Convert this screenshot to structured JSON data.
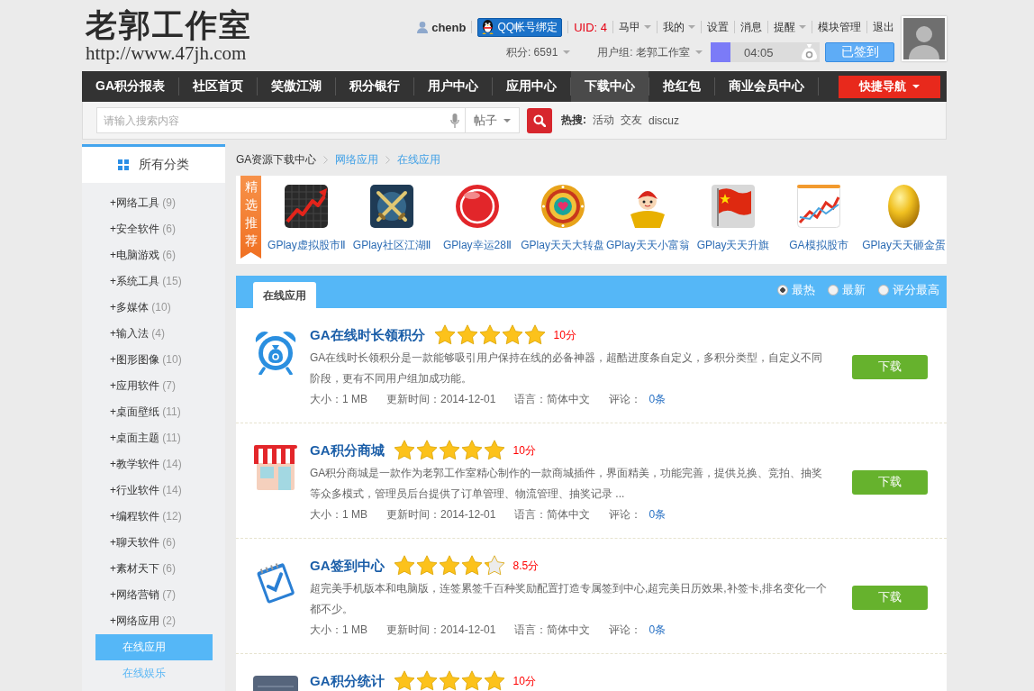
{
  "header": {
    "logo": "老郭工作室",
    "url": "http://www.47jh.com",
    "user": {
      "name": "chenb",
      "qq_bind": "QQ帐号绑定",
      "uid": "UID: 4"
    },
    "links": [
      {
        "label": "马甲",
        "dropdown": true
      },
      {
        "label": "我的",
        "dropdown": true
      },
      {
        "label": "设置",
        "dropdown": false
      },
      {
        "label": "消息",
        "dropdown": false
      },
      {
        "label": "提醒",
        "dropdown": true
      },
      {
        "label": "模块管理",
        "dropdown": false
      },
      {
        "label": "退出",
        "dropdown": false
      }
    ],
    "stats": [
      {
        "label": "积分: 6591",
        "dropdown": true
      },
      {
        "label": "用户组: 老郭工作室",
        "dropdown": true
      }
    ],
    "checkin": {
      "level": 0.18,
      "time": "04:05",
      "button": "已签到"
    }
  },
  "nav": {
    "items": [
      {
        "label": "GA积分报表",
        "selected": false
      },
      {
        "label": "社区首页",
        "selected": false
      },
      {
        "label": "笑傲江湖",
        "selected": false
      },
      {
        "label": "积分银行",
        "selected": false
      },
      {
        "label": "用户中心",
        "selected": false
      },
      {
        "label": "应用中心",
        "selected": false
      },
      {
        "label": "下载中心",
        "selected": true
      },
      {
        "label": "抢红包",
        "selected": false
      },
      {
        "label": "商业会员中心",
        "selected": false
      }
    ],
    "quick_nav": "快捷导航"
  },
  "search": {
    "placeholder": "请输入搜索内容",
    "scope": "帖子",
    "hot_label": "热搜:",
    "hot": [
      "活动",
      "交友",
      "discuz"
    ]
  },
  "sidebar": {
    "title": "所有分类",
    "categories": [
      {
        "label": "+网络工具",
        "count": "(9)"
      },
      {
        "label": "+安全软件",
        "count": "(6)"
      },
      {
        "label": "+电脑游戏",
        "count": "(6)"
      },
      {
        "label": "+系统工具",
        "count": "(15)"
      },
      {
        "label": "+多媒体",
        "count": "(10)"
      },
      {
        "label": "+输入法",
        "count": "(4)"
      },
      {
        "label": "+图形图像",
        "count": "(10)"
      },
      {
        "label": "+应用软件",
        "count": "(7)"
      },
      {
        "label": "+桌面壁纸",
        "count": "(11)"
      },
      {
        "label": "+桌面主题",
        "count": "(11)"
      },
      {
        "label": "+教学软件",
        "count": "(14)"
      },
      {
        "label": "+行业软件",
        "count": "(14)"
      },
      {
        "label": "+编程软件",
        "count": "(12)"
      },
      {
        "label": "+聊天软件",
        "count": "(6)"
      },
      {
        "label": "+素材天下",
        "count": "(6)"
      },
      {
        "label": "+网络营销",
        "count": "(7)"
      },
      {
        "label": "+网络应用",
        "count": "(2)",
        "children": [
          {
            "label": "在线应用",
            "selected": true
          },
          {
            "label": "在线娱乐",
            "selected": false
          }
        ]
      }
    ]
  },
  "breadcrumb": [
    "GA资源下载中心",
    "网络应用",
    "在线应用"
  ],
  "featured": {
    "ribbon": "精选推荐",
    "apps": [
      {
        "name": "GPlay虚拟股市Ⅱ",
        "kind": "stocks"
      },
      {
        "name": "GPlay社区江湖Ⅱ",
        "kind": "swords"
      },
      {
        "name": "GPlay幸运28Ⅱ",
        "kind": "ball"
      },
      {
        "name": "GPlay天天大转盘",
        "kind": "wheel"
      },
      {
        "name": "GPlay天天小富翁",
        "kind": "mascot"
      },
      {
        "name": "GPlay天天升旗",
        "kind": "flag"
      },
      {
        "name": "GA模拟股市",
        "kind": "chart"
      },
      {
        "name": "GPlay天天砸金蛋",
        "kind": "egg"
      }
    ]
  },
  "list": {
    "tabs": [
      {
        "label": "在线应用",
        "selected": true
      }
    ],
    "sort": [
      {
        "label": "最热",
        "selected": true
      },
      {
        "label": "最新",
        "selected": false
      },
      {
        "label": "评分最高",
        "selected": false
      }
    ],
    "apps": [
      {
        "kind": "clock",
        "title": "GA在线时长领积分",
        "stars": 5,
        "score": "10分",
        "description": "GA在线时长领积分是一款能够吸引用户保持在线的必备神器，超酷进度条自定义，多积分类型，自定义不同阶段，更有不同用户组加成功能。",
        "size": "大小：1 MB",
        "updated": "更新时间：2014-12-01",
        "language": "语言：简体中文",
        "comments_label": "评论：",
        "comments": "0条",
        "button": "下载"
      },
      {
        "kind": "store",
        "title": "GA积分商城",
        "stars": 5,
        "score": "10分",
        "description": "GA积分商城是一款作为老郭工作室精心制作的一款商城插件，界面精美，功能完善，提供兑换、竞拍、抽奖等众多模式，管理员后台提供了订单管理、物流管理、抽奖记录 ...",
        "size": "大小：1 MB",
        "updated": "更新时间：2014-12-01",
        "language": "语言：简体中文",
        "comments_label": "评论：",
        "comments": "0条",
        "button": "下载"
      },
      {
        "kind": "checklist",
        "title": "GA签到中心",
        "stars": 4.25,
        "score": "8.5分",
        "description": "超完美手机版本和电脑版，连签累签千百种奖励配置打造专属签到中心,超完美日历效果,补签卡,排名变化一个都不少。",
        "size": "大小：1 MB",
        "updated": "更新时间：2014-12-01",
        "language": "语言：简体中文",
        "comments_label": "评论：",
        "comments": "0条",
        "button": "下载"
      },
      {
        "kind": "stats",
        "title": "GA积分统计",
        "stars": 5,
        "score": "10分"
      }
    ]
  }
}
